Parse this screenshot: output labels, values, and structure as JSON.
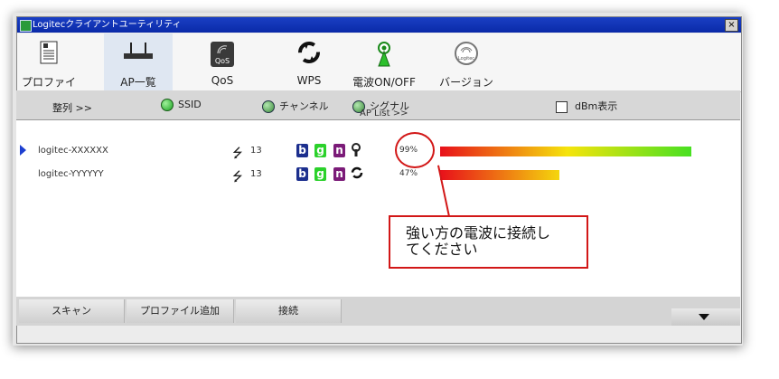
{
  "window": {
    "title": "Logitecクライアントユーティリティ",
    "close_label": "×"
  },
  "toolbar": {
    "items": [
      {
        "label": "プロファイル",
        "icon": "profile-document-icon"
      },
      {
        "label": "AP一覧",
        "icon": "router-icon",
        "selected": true
      },
      {
        "label": "QoS",
        "icon": "qos-icon",
        "icon_text": "QoS"
      },
      {
        "label": "WPS",
        "icon": "wps-icon"
      },
      {
        "label": "電波ON/OFF",
        "icon": "antenna-icon"
      },
      {
        "label": "バージョン",
        "icon": "logitec-version-icon",
        "icon_text": "Logitec"
      }
    ]
  },
  "sortbar": {
    "sort_label": "整列 >>",
    "ssid_label": "SSID",
    "channel_label": "チャンネル",
    "signal_label": "シグナル",
    "dbm_label": "dBm表示",
    "ap_list_label": "AP List >>"
  },
  "ap_list": [
    {
      "ssid": "logitec-XXXXXX",
      "channel": "13",
      "modes": [
        "b",
        "g",
        "n"
      ],
      "extra_icon": "lock-icon",
      "signal_percent": "99%",
      "signal_value": 99,
      "selected": true
    },
    {
      "ssid": "logitec-YYYYYY",
      "channel": "13",
      "modes": [
        "b",
        "g",
        "n"
      ],
      "extra_icon": "wps-icon",
      "signal_percent": "47%",
      "signal_value": 47,
      "selected": false
    }
  ],
  "annotation": {
    "line1": "強い方の電波に接続し",
    "line2": "てください"
  },
  "buttons": {
    "scan": "スキャン",
    "add_profile": "プロファイル追加",
    "connect": "接続"
  },
  "colors": {
    "title_bar": "#0a2aa8",
    "annotation_red": "#d21717",
    "bar_start": "#e8101a",
    "bar_mid": "#f5e40c",
    "bar_end": "#44e022"
  }
}
